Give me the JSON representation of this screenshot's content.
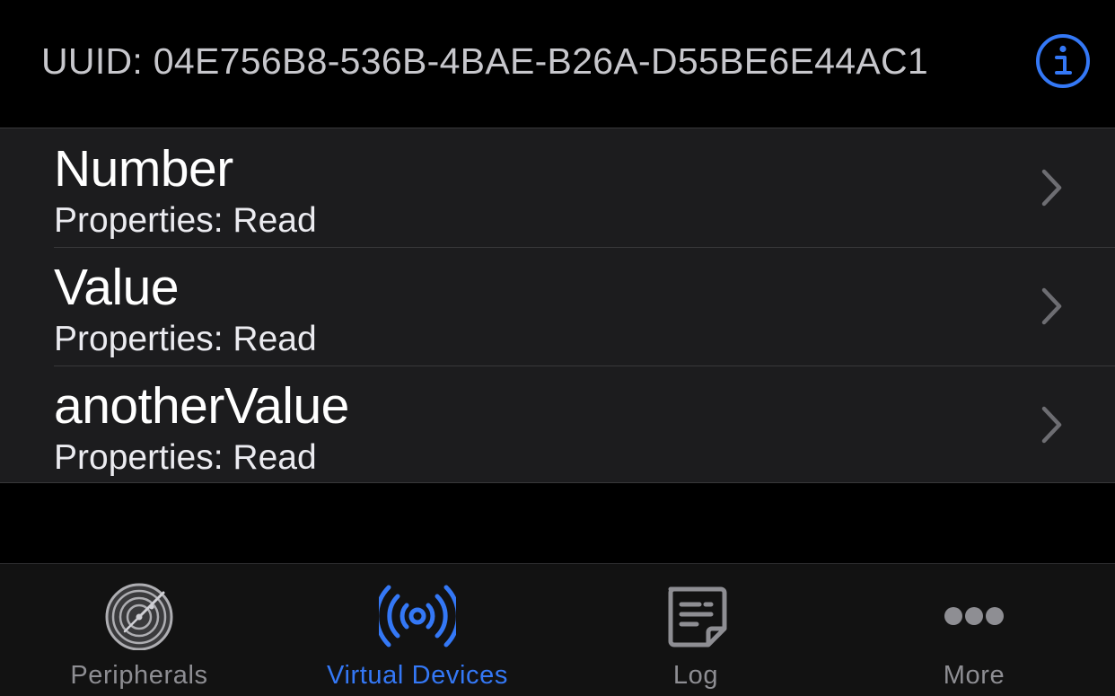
{
  "header": {
    "uuid_text": "UUID: 04E756B8-536B-4BAE-B26A-D55BE6E44AC1"
  },
  "characteristics": [
    {
      "name": "Number",
      "properties": "Properties: Read"
    },
    {
      "name": "Value",
      "properties": "Properties: Read"
    },
    {
      "name": "anotherValue",
      "properties": "Properties: Read"
    }
  ],
  "tabs": [
    {
      "label": "Peripherals",
      "icon": "radar-icon",
      "selected": false
    },
    {
      "label": "Virtual Devices",
      "icon": "broadcast-icon",
      "selected": true
    },
    {
      "label": "Log",
      "icon": "note-icon",
      "selected": false
    },
    {
      "label": "More",
      "icon": "ellipsis-icon",
      "selected": false
    }
  ],
  "colors": {
    "accent": "#3478f6",
    "tab_inactive": "#8e8e93",
    "row_background": "#1c1c1e",
    "background": "#000000"
  }
}
